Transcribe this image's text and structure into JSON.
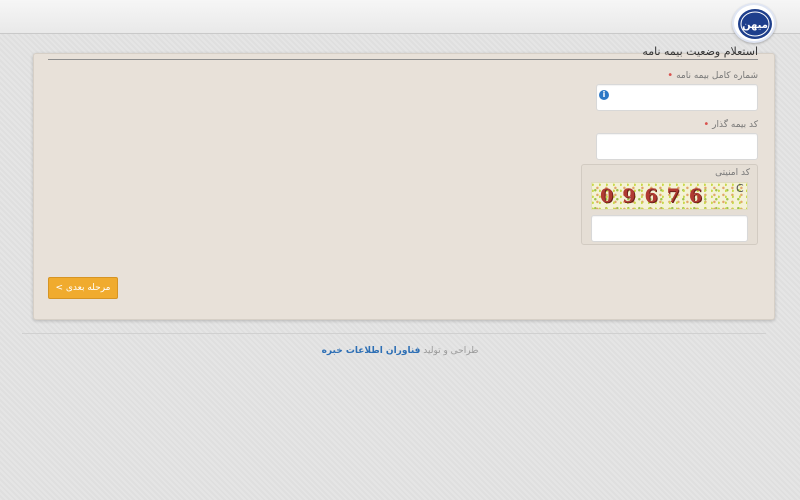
{
  "brand": {
    "logo_text": "میهن",
    "logo_icon": "mihan-insurance-logo"
  },
  "page": {
    "title": "استعلام وضعیت بیمه نامه"
  },
  "form": {
    "policy_number": {
      "label": "شماره کامل بیمه نامه",
      "required_mark": "•",
      "value": "",
      "info_icon": "i"
    },
    "insurer_code": {
      "label": "کد بیمه گذار",
      "required_mark": "•",
      "value": ""
    },
    "security": {
      "label": "کد امنیتی",
      "captcha_text": "09676",
      "refresh_icon": "C",
      "value": ""
    },
    "next_button": "مرحله بعدی >"
  },
  "footer": {
    "text": "طراحی و تولید",
    "link": "فناوران اطلاعات خبره"
  },
  "colors": {
    "panel_bg": "#e8e1d9",
    "accent_button": "#f0ab2e",
    "required": "#d9534f",
    "link": "#2d6fb5"
  }
}
